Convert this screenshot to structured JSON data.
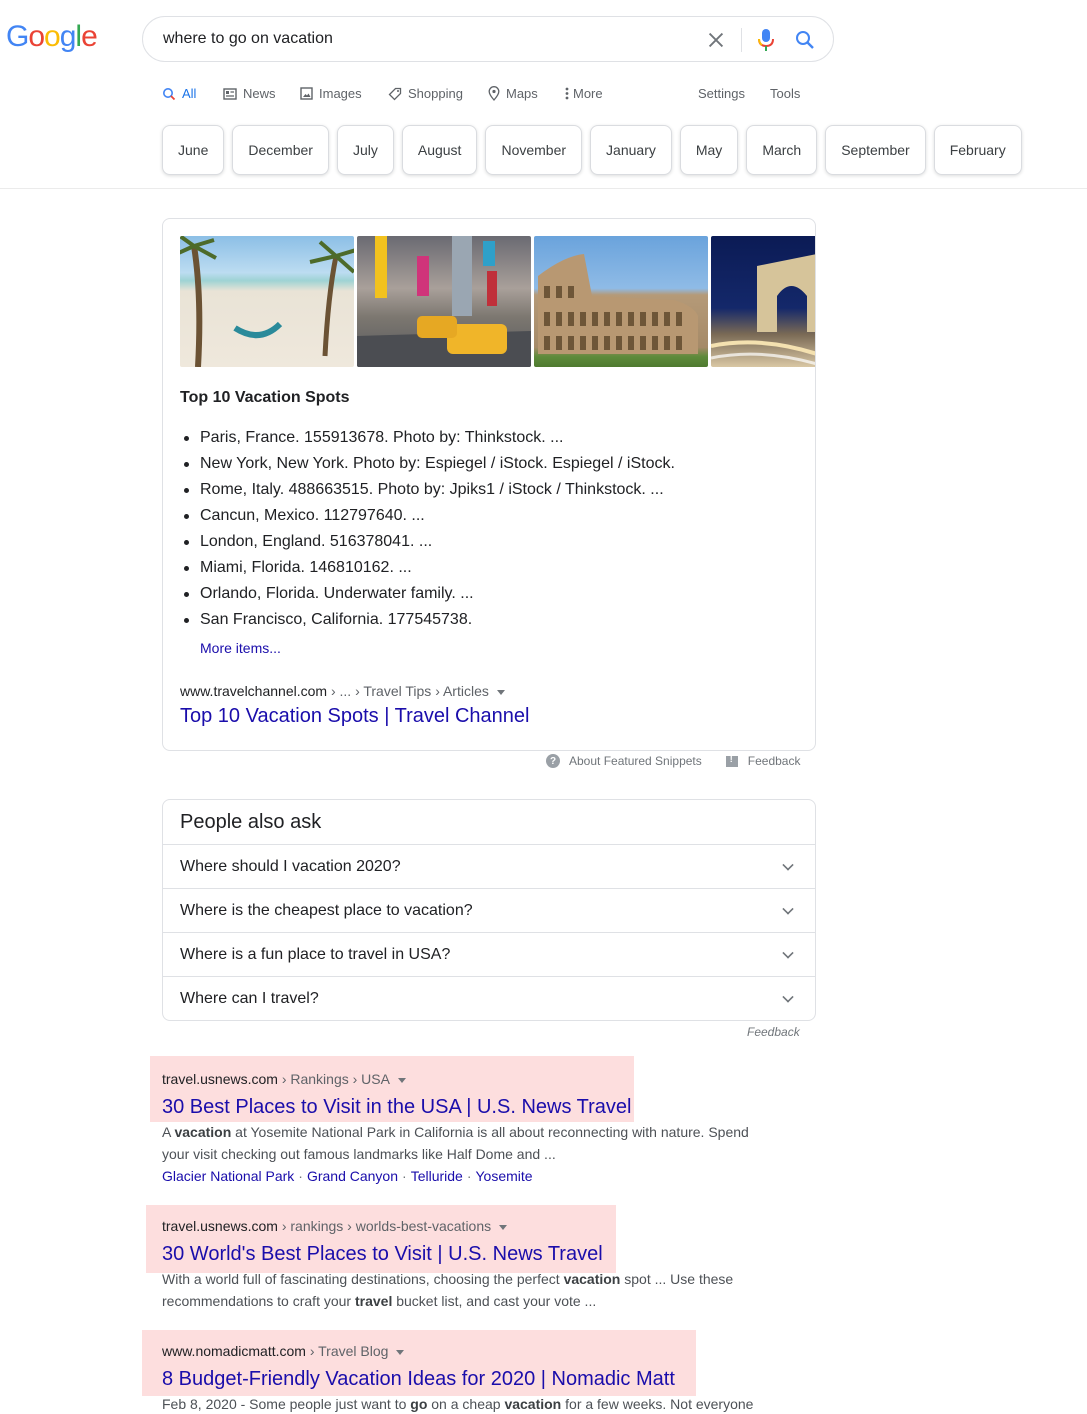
{
  "logo": {
    "letters": [
      {
        "ch": "G",
        "color": "#4285F4"
      },
      {
        "ch": "o",
        "color": "#EA4335"
      },
      {
        "ch": "o",
        "color": "#FBBC05"
      },
      {
        "ch": "g",
        "color": "#4285F4"
      },
      {
        "ch": "l",
        "color": "#34A853"
      },
      {
        "ch": "e",
        "color": "#EA4335"
      }
    ]
  },
  "search": {
    "query": "where to go on vacation",
    "clear_icon": "close-icon",
    "mic_icon": "microphone-icon",
    "search_icon": "search-icon"
  },
  "tabs": {
    "items": [
      {
        "label": "All",
        "icon": "search-icon",
        "active": true
      },
      {
        "label": "News",
        "icon": "newspaper-icon"
      },
      {
        "label": "Images",
        "icon": "image-icon"
      },
      {
        "label": "Shopping",
        "icon": "tag-icon"
      },
      {
        "label": "Maps",
        "icon": "map-pin-icon"
      },
      {
        "label": "More",
        "icon": "more-vert-icon"
      }
    ],
    "settings": "Settings",
    "tools": "Tools"
  },
  "chips": [
    "June",
    "December",
    "July",
    "August",
    "November",
    "January",
    "May",
    "March",
    "September",
    "February"
  ],
  "featured_snippet": {
    "images": [
      {
        "alt": "Beach with palm trees and hammock"
      },
      {
        "alt": "New York Times Square with yellow taxis"
      },
      {
        "alt": "Colosseum in Rome"
      },
      {
        "alt": "Arc de Triomphe in Paris at night"
      }
    ],
    "title": "Top 10 Vacation Spots",
    "items": [
      "Paris, France. 155913678. Photo by: Thinkstock. ...",
      "New York, New York. Photo by: Espiegel / iStock. Espiegel / iStock.",
      "Rome, Italy. 488663515. Photo by: Jpiks1 / iStock / Thinkstock. ...",
      "Cancun, Mexico. 112797640. ...",
      "London, England. 516378041. ...",
      "Miami, Florida. 146810162. ...",
      "Orlando, Florida. Underwater family. ...",
      "San Francisco, California. 177545738."
    ],
    "more_items": "More items...",
    "cite_domain": "www.travelchannel.com",
    "cite_path": " › ... › Travel Tips › Articles",
    "link": "Top 10 Vacation Spots | Travel Channel",
    "about": "About Featured Snippets",
    "feedback": "Feedback"
  },
  "people_also_ask": {
    "title": "People also ask",
    "questions": [
      "Where should I vacation 2020?",
      "Where is the cheapest place to vacation?",
      "Where is a fun place to travel in USA?",
      "Where can I travel?"
    ],
    "feedback": "Feedback"
  },
  "results": [
    {
      "domain": "travel.usnews.com",
      "path": " › Rankings › USA",
      "title": "30 Best Places to Visit in the USA | U.S. News Travel",
      "snippet_parts": [
        {
          "t": "A "
        },
        {
          "t": "vacation",
          "b": true
        },
        {
          "t": " at Yosemite National Park in California is all about reconnecting with nature. Spend your visit checking out famous landmarks like Half Dome and ..."
        }
      ],
      "sitelinks": [
        "Glacier National Park",
        "Grand Canyon",
        "Telluride",
        "Yosemite"
      ]
    },
    {
      "domain": "travel.usnews.com",
      "path": " › rankings › worlds-best-vacations",
      "title": "30 World's Best Places to Visit | U.S. News Travel",
      "snippet_parts": [
        {
          "t": "With a world full of fascinating destinations, choosing the perfect "
        },
        {
          "t": "vacation",
          "b": true
        },
        {
          "t": " spot ... Use these recommendations to craft your "
        },
        {
          "t": "travel",
          "b": true
        },
        {
          "t": " bucket list, and cast your vote ..."
        }
      ]
    },
    {
      "domain": "www.nomadicmatt.com",
      "path": " › Travel Blog",
      "title": "8 Budget-Friendly Vacation Ideas for 2020 | Nomadic Matt",
      "snippet_parts": [
        {
          "t": "Feb 8, 2020 - Some people just want to "
        },
        {
          "t": "go",
          "b": true
        },
        {
          "t": " on a cheap "
        },
        {
          "t": "vacation",
          "b": true
        },
        {
          "t": " for a few weeks. Not everyone"
        }
      ]
    }
  ],
  "highlight_color": "#fddede"
}
